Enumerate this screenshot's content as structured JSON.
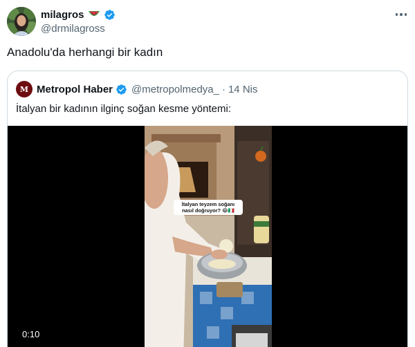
{
  "author": {
    "display_name": "milagros",
    "emoji_icon": "watermelon-icon",
    "handle": "@drmilagross",
    "verified": true
  },
  "tweet": {
    "text": "Anadolu'da herhangi bir kadın"
  },
  "quoted": {
    "avatar_letter": "M",
    "display_name": "Metropol Haber",
    "verified": true,
    "handle": "@metropolmedya_",
    "separator": "·",
    "date": "14 Nis",
    "text": "İtalyan bir kadının ilginç soğan kesme yöntemi:"
  },
  "video": {
    "caption": "İtalyan teyzem soğanı nasıl doğruyor? 😂🇮🇹",
    "duration": "0:10"
  },
  "colors": {
    "verified_blue": "#1d9bf0",
    "secondary_text": "#536471",
    "border": "#cfd9de"
  }
}
